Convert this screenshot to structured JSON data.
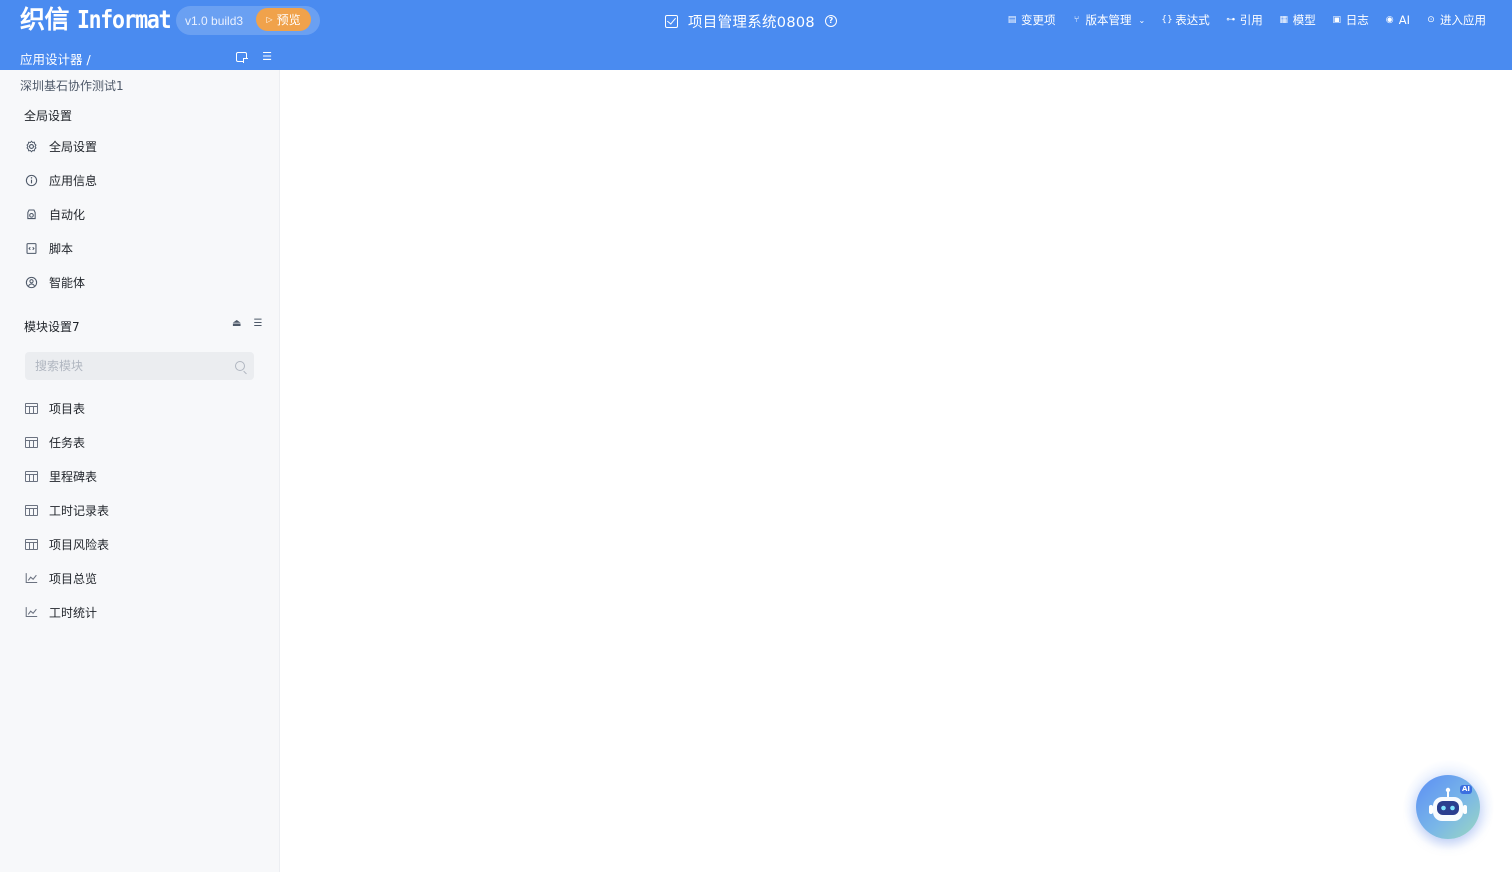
{
  "header": {
    "logo_cn": "织信",
    "logo_en": "Informat",
    "version": "v1.0 build3",
    "preview_label": "预览",
    "app_title": "项目管理系统0808",
    "breadcrumb": "应用设计器 /",
    "nav": [
      {
        "icon": "list-doc-icon",
        "label": "变更项"
      },
      {
        "icon": "branch-icon",
        "label": "版本管理"
      },
      {
        "icon": "braces-icon",
        "label": "表达式"
      },
      {
        "icon": "reference-icon",
        "label": "引用"
      },
      {
        "icon": "model-icon",
        "label": "模型"
      },
      {
        "icon": "log-icon",
        "label": "日志"
      },
      {
        "icon": "ai-icon",
        "label": "AI"
      },
      {
        "icon": "enter-icon",
        "label": "进入应用"
      }
    ],
    "colors": {
      "bar": "#4a8bf0",
      "preview": "#f0a24b"
    }
  },
  "sidebar": {
    "workspace": "深圳基石协作测试1",
    "global_section": "全局设置",
    "global_items": [
      {
        "icon": "gear-icon",
        "label": "全局设置"
      },
      {
        "icon": "info-icon",
        "label": "应用信息"
      },
      {
        "icon": "automation-icon",
        "label": "自动化"
      },
      {
        "icon": "script-icon",
        "label": "脚本"
      },
      {
        "icon": "agent-icon",
        "label": "智能体"
      }
    ],
    "module_section": "模块设置7",
    "search_placeholder": "搜索模块",
    "modules": [
      {
        "icon": "table-icon",
        "label": "项目表"
      },
      {
        "icon": "table-icon",
        "label": "任务表"
      },
      {
        "icon": "table-icon",
        "label": "里程碑表"
      },
      {
        "icon": "table-icon",
        "label": "工时记录表"
      },
      {
        "icon": "table-icon",
        "label": "项目风险表"
      },
      {
        "icon": "chart-icon",
        "label": "项目总览"
      },
      {
        "icon": "chart-icon",
        "label": "工时统计"
      }
    ]
  },
  "ai_assistant": {
    "badge": "AI"
  }
}
